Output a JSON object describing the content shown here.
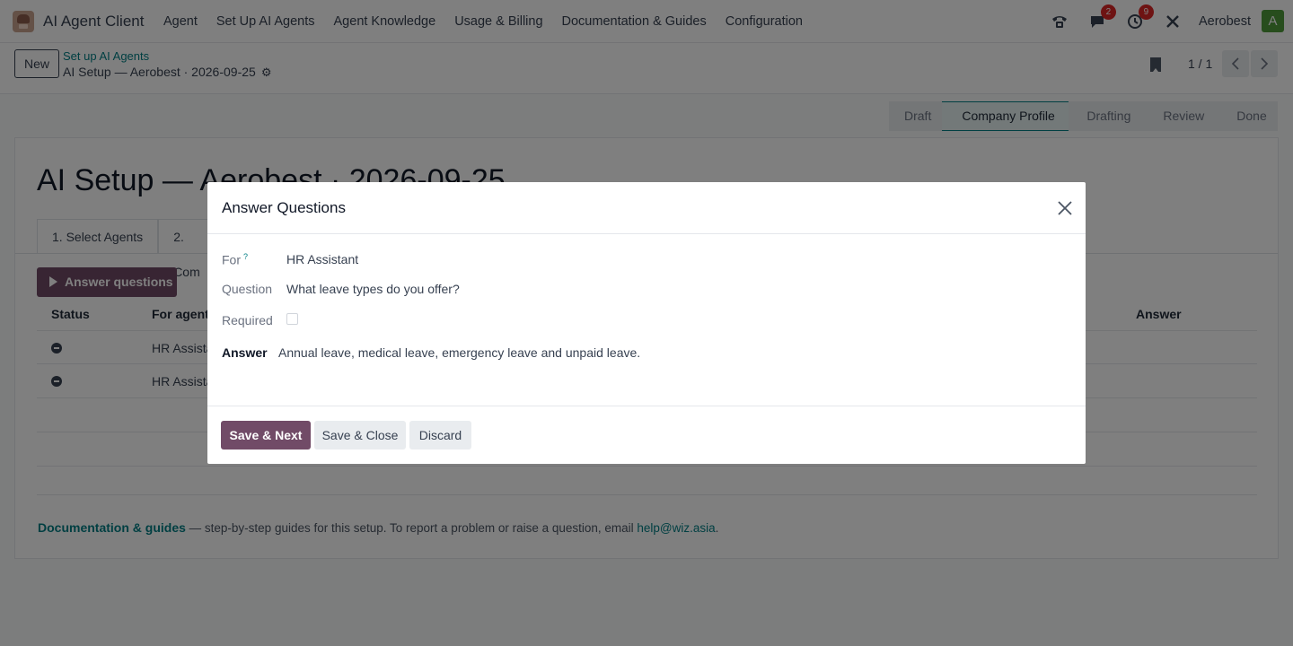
{
  "app": {
    "title": "AI Agent Client"
  },
  "menu": [
    "Agent",
    "Set Up AI Agents",
    "Agent Knowledge",
    "Usage & Billing",
    "Documentation & Guides",
    "Configuration"
  ],
  "navbar": {
    "messages_count": "2",
    "activities_count": "9",
    "company": "Aerobest",
    "avatar_letter": "A"
  },
  "control": {
    "new_label": "New",
    "breadcrumb_parent": "Set up AI Agents",
    "breadcrumb_current": "AI Setup — Aerobest · 2026-09-25",
    "pager": "1 / 1"
  },
  "status_stages": [
    "Draft",
    "Company Profile",
    "Drafting",
    "Review",
    "Done"
  ],
  "active_stage": "Company Profile",
  "form": {
    "title": "AI Setup — Aerobest · 2026-09-25",
    "tabs": [
      "1. Select Agents",
      "2. Com"
    ],
    "answer_button": "Answer questions",
    "columns": {
      "status": "Status",
      "for_agent": "For agent",
      "answer": "Answer"
    },
    "rows": [
      {
        "for_agent": "HR Assista"
      },
      {
        "for_agent": "HR Assista"
      }
    ],
    "footer": {
      "link": "Documentation & guides",
      "text": " — step-by-step guides for this setup. To report a problem or raise a question, email ",
      "email": "help@wiz.asia",
      "end": "."
    }
  },
  "modal": {
    "title": "Answer Questions",
    "for_label": "For",
    "for_help": "?",
    "for_value": "HR Assistant",
    "question_label": "Question",
    "question_value": "What leave types do you offer?",
    "required_label": "Required",
    "required_checked": false,
    "answer_label": "Answer",
    "answer_value": "Annual leave, medical leave, emergency leave and unpaid leave.",
    "buttons": {
      "save_next": "Save & Next",
      "save_close": "Save & Close",
      "discard": "Discard"
    }
  },
  "colors": {
    "primary": "#714b67",
    "link": "#017e84",
    "badge": "#dc2626",
    "avatar": "#4e9a3b"
  }
}
